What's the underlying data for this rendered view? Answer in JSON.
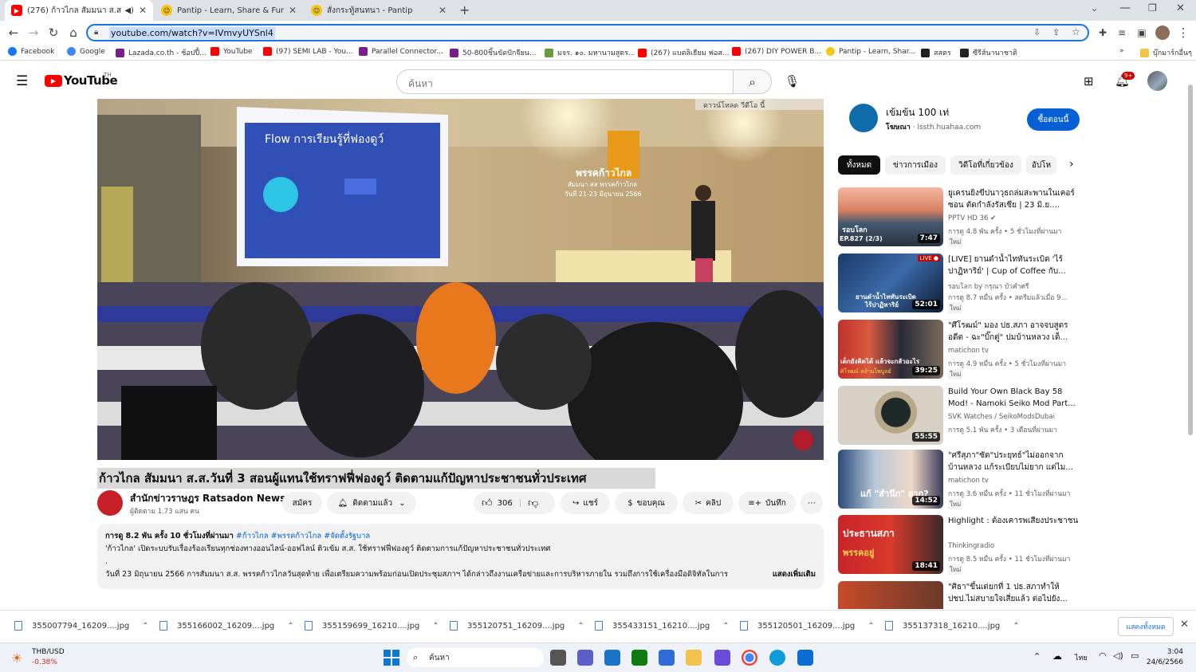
{
  "tabs": [
    {
      "title": "(276) ก้าวไกล สัมมนา ส.ส.วันที่ 3",
      "active": true
    },
    {
      "title": "Pantip - Learn, Share & Fun",
      "active": false
    },
    {
      "title": "สั่งกระทู้สนทนา - Pantip",
      "active": false
    }
  ],
  "address": {
    "url": "youtube.com/watch?v=IVmvyUYSnl4"
  },
  "bookmarks": [
    "Facebook",
    "Google",
    "Lazada.co.th - ช้อปปี้...",
    "YouTube",
    "(97) SEMI LAB - You...",
    "Parallel Connector...",
    "50-800ชิ้นขัดปักจียน...",
    "มจร. ๑๐. มหานามสูตร...",
    "(267) แบตลิเธียม ฟอส...",
    "(267) DIY POWER B...",
    "Pantip - Learn, Shar...",
    "สสตร",
    "ซีรีส์นานาชาติ"
  ],
  "bookmarks_more": "»",
  "bookmarks_other": "บุ๊กมาร์กอื่นๆ",
  "youtube": {
    "logo": "YouTube",
    "logo_sup": "TH",
    "search_placeholder": "ค้นหา",
    "notif_count": "9+"
  },
  "video": {
    "skip_label": "ดาวน์โหลด วีดีโอ นี้",
    "banner": "พรรคก้าวไกล",
    "banner_sub": "สัมมนา สส พรรคก้าวไกล",
    "banner_date": "วันที่ 21-23 มิถุนายน 2566",
    "screen_text": "Flow การเรียนรู้ที่ฟองดูว์"
  },
  "title": "ก้าวไกล สัมมนา ส.ส.วันที่ 3 สอนผู้แทนใช้ทราฟฟี่ฟองดูว์ ติดตามแก้ปัญหาประชาชนทั่วประเทศ",
  "channel": {
    "name": "สำนักข่าวราษฎร Ratsadon News",
    "subs": "ผู้ติดตาม 1.73 แสน คน",
    "join": "สมัคร",
    "subscribed": "ติดตามแล้ว"
  },
  "actions": {
    "likes": "306",
    "share": "แชร์",
    "thanks": "ขอบคุณ",
    "clip": "คลิป",
    "save": "บันทึก",
    "more": "⋯"
  },
  "description": {
    "meta": "การดู 8.2 พัน ครั้ง  10 ชั่วโมงที่ผ่านมา",
    "tags": "#ก้าวไกล #พรรคก้าวไกล #จัดตั้งรัฐบาล",
    "line1": "'ก้าวไกล' เปิดระบบรับเรื่องร้องเรียนทุกช่องทางออนไลน์-ออฟไลน์ ติวเข้ม ส.ส. ใช้ทราฟฟี่ฟองดูว์ ติดตามการแก้ปัญหาประชาชนทั่วประเทศ",
    "dot": ".",
    "line2": "วันที่ 23 มิถุนายน 2566 การสัมมนา ส.ส. พรรคก้าวไกลวันสุดท้าย เพื่อเตรียมความพร้อมก่อนเปิดประชุมสภาฯ ได้กล่าวถึงงานเครือข่ายและการบริหารภายใน รวมถึงการใช้เครื่องมือดิจิทัลในการ",
    "show_more": "แสดงเพิ่มเติม"
  },
  "ad": {
    "title": "เข้มข้น 100 เท่",
    "label": "โฆษณา",
    "dot": "·",
    "url": "lssth.huahaa.com",
    "cta": "ซื้อตอนนี้"
  },
  "chips": [
    "ทั้งหมด",
    "ข่าวการเมือง",
    "วิดีโอที่เกี่ยวข้อง",
    "อัปโห"
  ],
  "recs": [
    {
      "title": "ยูเครนยิงขีปนาวุธถล่มสะพานในเคอร์ซอน ตัดกำลังรัสเซีย | 23 มิ.ย....",
      "channel": "PPTV HD 36",
      "meta": "การดู 4.8 พัน ครั้ง  •  5 ชั่วโมงที่ผ่านมา",
      "new": "ใหม่",
      "dur": "7:47",
      "thumb_text": "รอบโลก",
      "thumb_sub": "EP.827 (2/3)"
    },
    {
      "title": "[LIVE] ยานดำน้ำไททันระเบิด 'ไร้ปาฏิหาริย์' | Cup of Coffee กับ...",
      "channel": "รอบโลก by กรุณา บัวคำศรี",
      "meta": "การดู 8.7 หมื่น ครั้ง  •  สตรีมแล้วเมื่อ 9...",
      "new": "ใหม่",
      "dur": "52:01",
      "thumb_text": "ยานดำน้ำไททันระเบิด",
      "thumb_sub": "ไร้ปาฏิหาริย์"
    },
    {
      "title": "\"ศึโรฒม์\" มอง ปธ.สภา อาจจบสูตรอดีต - ฉะ\"บิ๊กตู่\" ปมบ้านหลวง เด็...",
      "channel": "matichon tv",
      "meta": "การดู 4.9 หมื่น ครั้ง  •  5 ชั่วโมงที่ผ่านมา",
      "new": "ใหม่",
      "dur": "39:25",
      "thumb_text": "เด็กยังคิดได้ แล้วจะกลัวอะไร",
      "thumb_sub": "ศิโรฒม์ คล้ามไพบูลย์"
    },
    {
      "title": "Build Your Own Black Bay 58 Mod! - Namoki Seiko Mod Part...",
      "channel": "SVK Watches / SeikoModsDubai",
      "meta": "การดู 5.1 พัน ครั้ง  •  3 เดือนที่ผ่านมา",
      "new": "",
      "dur": "55:55",
      "thumb_text": "",
      "thumb_sub": ""
    },
    {
      "title": "\"ศรีสุภา\"ซัด\"ประยุทธ์\"ไม่ออกจากบ้านหลวง แก้ระเบียบไม่ยาก แต่ไม...",
      "channel": "matichon tv",
      "meta": "การดู 3.6 หมื่น ครั้ง  •  11 ชั่วโมงที่ผ่านมา",
      "new": "ใหม่",
      "dur": "14:52",
      "thumb_text": "แก้ \"สำนึก\" ยาก?",
      "thumb_sub": ""
    },
    {
      "title": "Highlight : ต้องเคารพเสียงประชาชน",
      "channel": "Thinkingradio",
      "meta": "การดู 8.5 หมื่น ครั้ง  •  11 ชั่วโมงที่ผ่านมา",
      "new": "ใหม่",
      "dur": "18:41",
      "thumb_text": "ประธานสภา",
      "thumb_sub": "พรรคอยู่"
    },
    {
      "title": "\"ศิธา\"ขึ้นเด่ยกที่ 1 ปธ.สภาทำให้ ปชป.ไม่สบายใจเสี่ยแล้ว ต่อไปยัง...",
      "channel": "",
      "meta": "",
      "new": "",
      "dur": "",
      "thumb_text": "",
      "thumb_sub": ""
    }
  ],
  "downloads": [
    "355007794_16209....jpg",
    "355166002_16209....jpg",
    "355159699_16210....jpg",
    "355120751_16209....jpg",
    "355433151_16210....jpg",
    "355120501_16209....jpg",
    "355137318_16210....jpg"
  ],
  "downloads_showall": "แสดงทั้งหมด",
  "taskbar": {
    "ticker": "THB/USD",
    "change": "-0.38%",
    "search": "ค้นหา",
    "lang": "ไทย",
    "time": "3:04",
    "date": "24/6/2566"
  }
}
